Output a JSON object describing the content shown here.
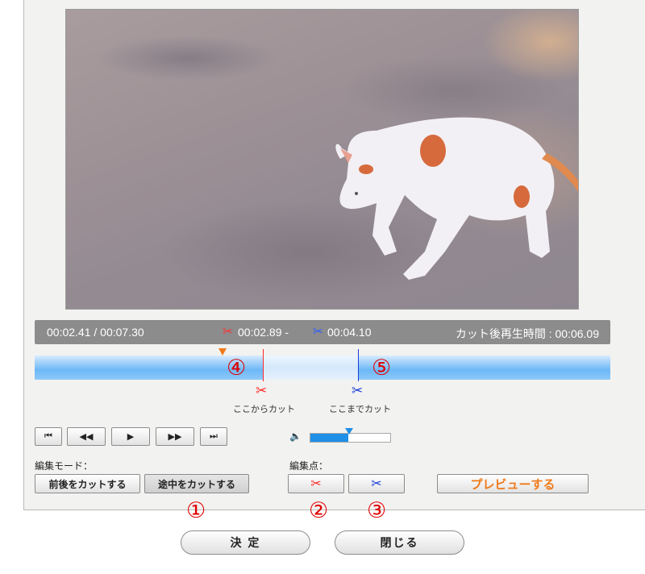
{
  "info": {
    "current_time": "00:02.41 / 00:07.30",
    "cut_start": "00:02.89",
    "cut_range": "00:02.89 - ",
    "cut_end": "00:04.10",
    "after_cut_length": "カット後再生時間 : 00:06.09"
  },
  "timeline": {
    "playhead_fraction": 0.33,
    "cut_in_fraction": 0.396,
    "cut_out_fraction": 0.562,
    "in_label": "ここからカット",
    "out_label": "ここまでカット"
  },
  "annotations": {
    "n1": "①",
    "n2": "②",
    "n3": "③",
    "n4": "④",
    "n5": "⑤"
  },
  "controls": {
    "go_start": "⏮",
    "rewind": "◀◀",
    "play": "▶",
    "forward": "▶▶",
    "go_end": "⏭",
    "volume_level": 0.47
  },
  "edit_mode": {
    "label": "編集モード：",
    "options": [
      "前後をカットする",
      "途中をカットする"
    ],
    "selected": "途中をカットする"
  },
  "edit_points": {
    "label": "編集点："
  },
  "preview_label": "プレビューする",
  "footer": {
    "ok": "決 定",
    "close": "閉じる"
  },
  "colors": {
    "cut_in": "#ff2a2a",
    "cut_out": "#1a3bd6",
    "accent": "#f07a1a",
    "timeline": "#6db8f6"
  },
  "icons": {
    "cut_in": "scissors-red-icon",
    "cut_out": "scissors-blue-icon",
    "volume": "speaker-icon"
  }
}
